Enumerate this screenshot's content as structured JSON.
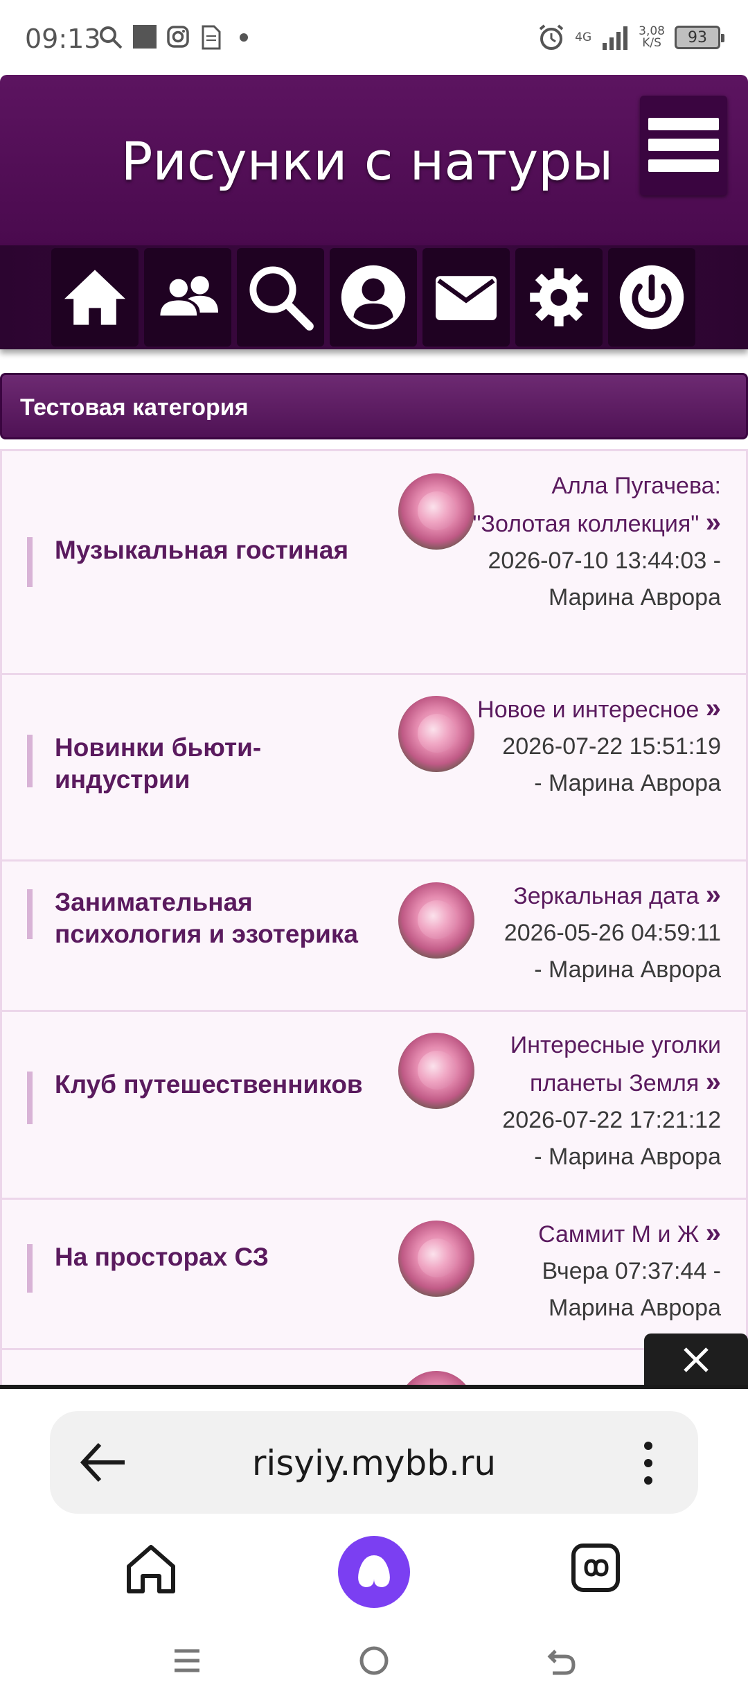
{
  "status_bar": {
    "time": "09:13",
    "network": "4G",
    "speed_value": "3,08",
    "speed_unit": "K/S",
    "battery": "93",
    "icons": [
      "search-icon",
      "square-icon",
      "instagram-icon",
      "file-icon",
      "dot-icon",
      "alarm-icon",
      "signal-icon"
    ]
  },
  "header": {
    "title": "Рисунки с натуры",
    "menu_icon": "hamburger-icon"
  },
  "nav_icons": [
    "home-icon",
    "users-icon",
    "search-icon",
    "profile-icon",
    "mail-icon",
    "settings-icon",
    "power-icon"
  ],
  "category": {
    "title": "Тестовая категория"
  },
  "forums": [
    {
      "title": "Музыкальная гостиная",
      "last_topic": "Алла Пугачева: \"Золотая коллекция\"",
      "raquo": "»",
      "date": "2026-07-10 13:44:03 -",
      "author": "Марина Аврора"
    },
    {
      "title": "Новинки бьюти-индустрии",
      "last_topic": "Новое и интересное",
      "raquo": "»",
      "date": "2026-07-22 15:51:19",
      "author": "- Марина Аврора"
    },
    {
      "title": "Занимательная психология и эзотерика",
      "last_topic": "Зеркальная дата",
      "raquo": "»",
      "date": "2026-05-26 04:59:11",
      "author": "- Марина Аврора"
    },
    {
      "title": "Клуб путешественников",
      "last_topic": "Интересные уголки планеты Земля",
      "raquo": "»",
      "date": "2026-07-22 17:21:12",
      "author": "- Марина Аврора"
    },
    {
      "title": "На просторах СЗ",
      "last_topic": "Саммит М и Ж",
      "raquo": "»",
      "date": "Вчера 07:37:44 -",
      "author": "Марина Аврора"
    }
  ],
  "browser": {
    "url": "risyiy.mybb.ru",
    "back_icon": "back-arrow-icon",
    "menu_icon": "more-vert-icon",
    "nav": [
      "home-icon",
      "alice-assistant-icon",
      "tabs-icon"
    ],
    "system_nav": [
      "menu-icon",
      "home-circle-icon",
      "back-icon"
    ]
  },
  "colors": {
    "header": "#5c1460",
    "nav_row": "#2c0530",
    "category_bar": "#6d2a72",
    "link": "#5a1a5e",
    "row_bg": "#fcf5fb",
    "accent_assistant": "#7b3ff2"
  }
}
